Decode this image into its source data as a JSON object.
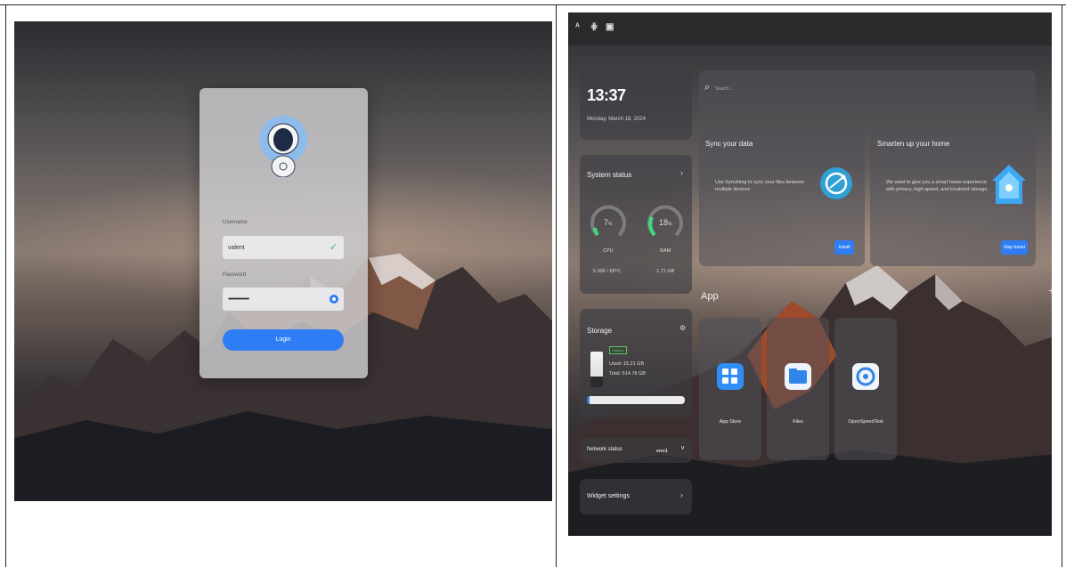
{
  "login": {
    "username_label": "Username",
    "username_value": "valent",
    "password_label": "Password",
    "password_value": "••••••••••••••••",
    "login_button": "Login"
  },
  "topbar": {
    "icons": [
      "person-icon",
      "grid-icon",
      "monitor-icon"
    ]
  },
  "clock": {
    "time": "13:37",
    "date": "Monday, March 18, 2024"
  },
  "search": {
    "placeholder": "Search..."
  },
  "system_status": {
    "title": "System status",
    "cpu_percent": "7",
    "cpu_label": "CPU",
    "cpu_detail": "5.30F / 60°C",
    "ram_percent": "18",
    "ram_label": "RAM",
    "ram_detail": "1.71 GB",
    "unit": "%"
  },
  "storage": {
    "title": "Storage",
    "badge": "Healthy",
    "used": "Used: 15.21 GB",
    "total": "Total: 514.78 GB",
    "used_fraction": 0.03
  },
  "network": {
    "title": "Network status",
    "interface": "eno1"
  },
  "widget_settings": {
    "title": "Widget settings"
  },
  "sync_card": {
    "title": "Sync your data",
    "text": "Use Syncthing to sync your files between multiple devices",
    "button": "Install"
  },
  "home_card": {
    "title": "Smarten up your home",
    "text": "We want to give you a smart home experience with privacy, high speed, and localized storage.",
    "button": "Stay tuned"
  },
  "apps": {
    "title": "App",
    "items": [
      {
        "label": "App Store"
      },
      {
        "label": "Files"
      },
      {
        "label": "OpenSpeedTest"
      }
    ]
  },
  "colors": {
    "accent": "#2f7df5",
    "gauge": "#3ddc84"
  }
}
